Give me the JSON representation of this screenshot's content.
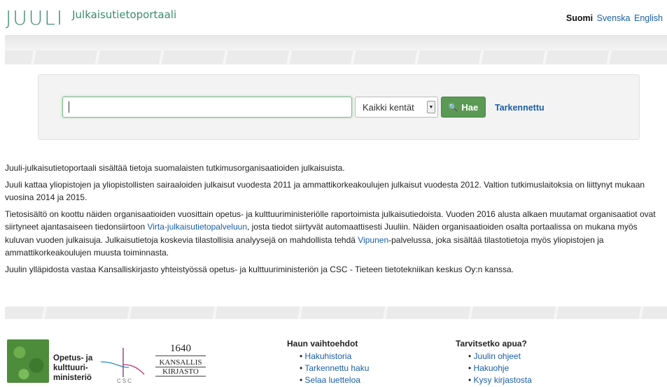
{
  "header": {
    "logo": "JUULI",
    "subtitle": "Julkaisutietoportaali",
    "languages": {
      "active": "Suomi",
      "options": [
        "Svenska",
        "English"
      ]
    }
  },
  "search": {
    "input_value": "",
    "field_select": "Kaikki kentät",
    "button_label": "Hae",
    "advanced_link": "Tarkennettu"
  },
  "content": {
    "p1": "Juuli-julkaisutietoportaali sisältää tietoja suomalaisten tutkimusorganisaatioiden julkaisuista.",
    "p2": "Juuli kattaa yliopistojen ja yliopistollisten sairaaloiden julkaisut vuodesta 2011 ja ammattikorkeakoulujen julkaisut vuodesta 2012. Valtion tutkimuslaitoksia on liittynyt mukaan vuosina 2014 ja 2015.",
    "p3_a": "Tietosisältö on koottu näiden organisaatioiden vuosittain opetus- ja kulttuuriministeriölle raportoimista julkaisutiedoista. Vuoden 2016 alusta alkaen muutamat organisaatiot ovat siirtyneet ajantasaiseen tiedonsiirtoon ",
    "p3_link1": "Virta-julkaisutietopalveluun",
    "p3_b": ", josta tiedot siirtyvät automaattisesti Juuliin. Näiden organisaatioiden osalta portaalissa on mukana myös kuluvan vuoden julkaisuja. Julkaisutietoja koskevia tilastollisia analyysejä on mahdollista tehdä ",
    "p3_link2": "Vipunen",
    "p3_c": "-palvelussa, joka sisältää tilastotietoja myös yliopistojen ja ammattikorkeakoulujen muusta toiminnasta.",
    "p4": "Juulin ylläpidosta vastaa Kansalliskirjasto yhteistyössä opetus- ja kulttuuriministeriön ja CSC - Tieteen tietotekniikan keskus Oy:n kanssa."
  },
  "footer": {
    "okm_lines": [
      "Opetus- ja",
      "kulttuuri-",
      "ministeriö"
    ],
    "csc_label": "CSC",
    "kk_year": "1640",
    "kk_name_lines": [
      "KANSALLIS",
      "KIRJASTO"
    ],
    "col1": {
      "title": "Haun vaihtoehdot",
      "items": [
        "Hakuhistoria",
        "Tarkennettu haku",
        "Selaa luetteloa"
      ]
    },
    "col2": {
      "title": "Tarvitsetko apua?",
      "items": [
        "Juulin ohjeet",
        "Hakuohje",
        "Kysy kirjastosta"
      ]
    }
  },
  "colors": {
    "brand": "#3b8a6e",
    "link": "#1a5ea8",
    "button": "#5a9a55"
  }
}
